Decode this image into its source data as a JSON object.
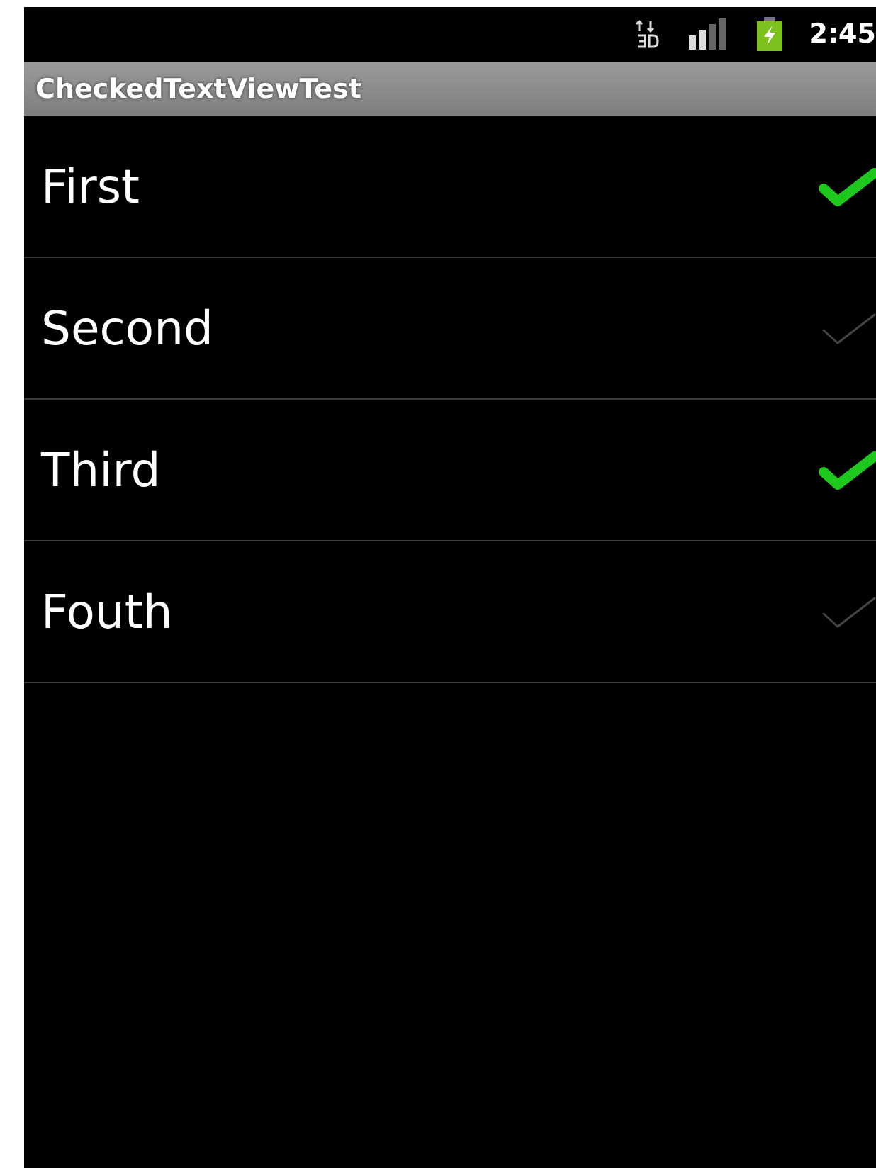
{
  "status_bar": {
    "time": "2:45"
  },
  "title_bar": {
    "title": "CheckedTextViewTest"
  },
  "items": [
    {
      "label": "First",
      "checked": true
    },
    {
      "label": "Second",
      "checked": false
    },
    {
      "label": "Third",
      "checked": true
    },
    {
      "label": "Fouth",
      "checked": false
    }
  ]
}
